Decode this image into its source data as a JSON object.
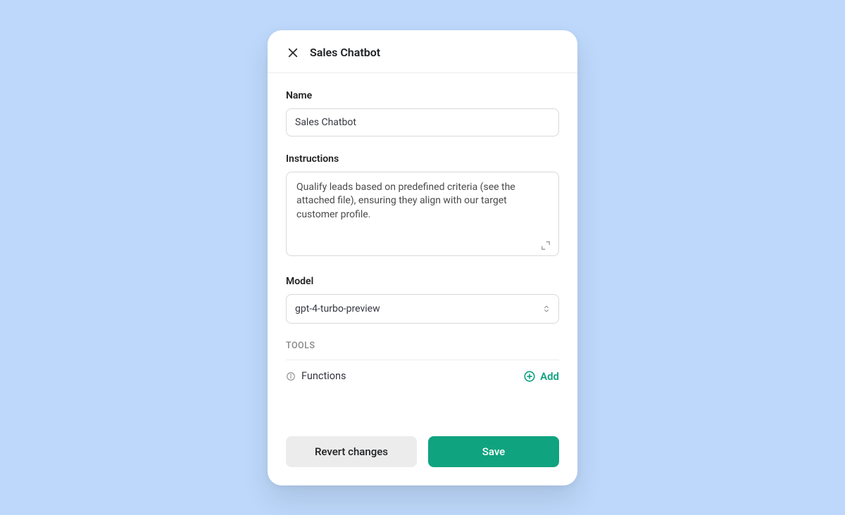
{
  "header": {
    "title": "Sales Chatbot"
  },
  "form": {
    "name": {
      "label": "Name",
      "value": "Sales Chatbot"
    },
    "instructions": {
      "label": "Instructions",
      "value": "Qualify leads based on predefined criteria (see the attached file), ensuring they align with our target customer profile."
    },
    "model": {
      "label": "Model",
      "value": "gpt-4-turbo-preview"
    }
  },
  "tools": {
    "section_label": "TOOLS",
    "functions_label": "Functions",
    "add_label": "Add"
  },
  "footer": {
    "revert_label": "Revert changes",
    "save_label": "Save"
  },
  "colors": {
    "accent": "#10a37f",
    "background": "#bdd8fb"
  }
}
